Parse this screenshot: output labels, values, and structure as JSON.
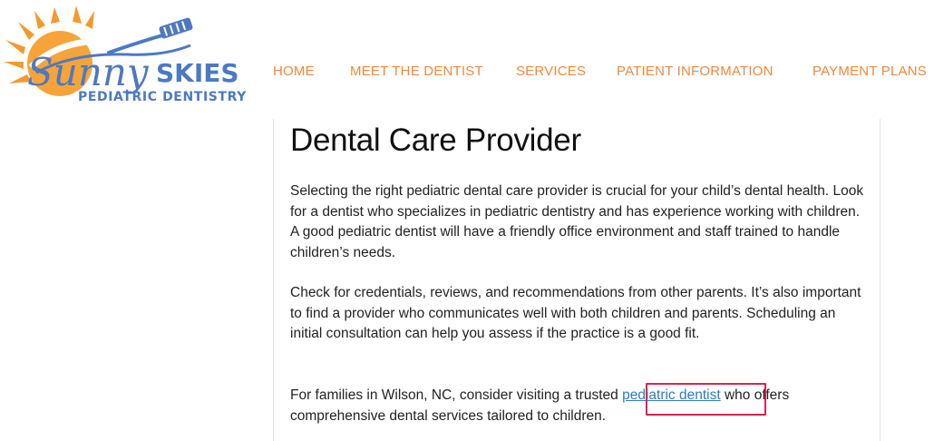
{
  "brand": {
    "name_script": "Sunny",
    "name_bold": "SKIES",
    "tagline": "PEDIATRIC DENTISTRY",
    "colors": {
      "orange": "#f39a2d",
      "blue": "#4d79c2"
    }
  },
  "nav": {
    "items": [
      "HOME",
      "MEET THE DENTIST",
      "SERVICES",
      "PATIENT INFORMATION",
      "PAYMENT PLANS"
    ],
    "color": "#f0883a"
  },
  "article": {
    "title": "Dental Care Provider",
    "para1": "Selecting the right pediatric dental care provider is crucial for your child’s dental health. Look for a dentist who specializes in pediatric dentistry and has experience working with children. A good pediatric dentist will have a friendly office environment and staff trained to handle children’s needs.",
    "para2": "Check for credentials, reviews, and recommendations from other parents. It’s also important to find a provider who communicates well with both children and parents. Scheduling an initial consultation can help you assess if the practice is a good fit.",
    "para3_before": "For families in Wilson, NC, consider visiting a trusted ",
    "para3_link": "pediatric dentist",
    "para3_after": " who offers comprehensive dental services tailored to children.",
    "link_color": "#2f79c6",
    "highlight_color": "#d9244e"
  }
}
